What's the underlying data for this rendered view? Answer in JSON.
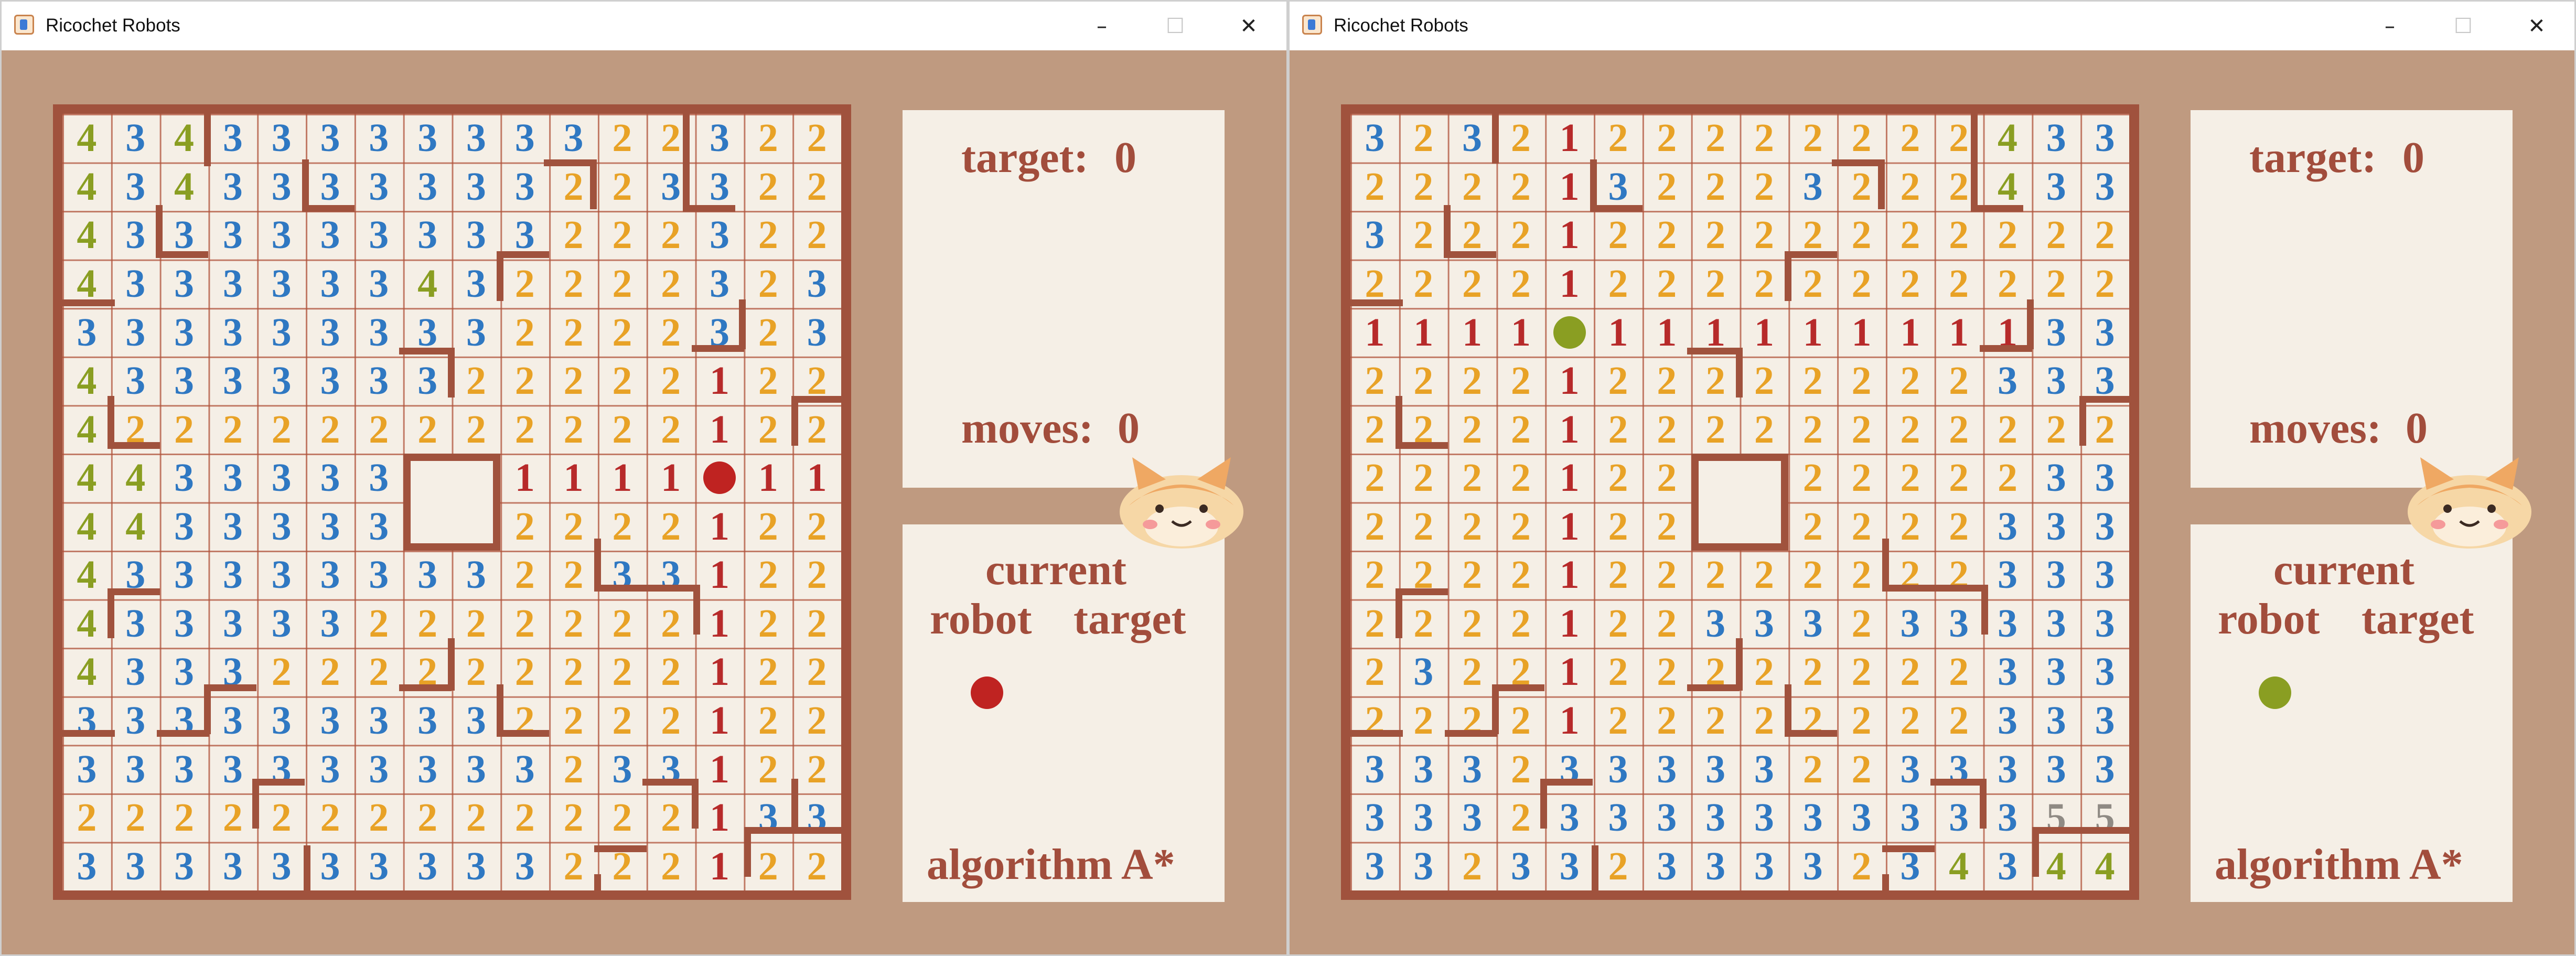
{
  "colors": {
    "1": "#b72a2a",
    "2": "#e8a226",
    "3": "#2f78c2",
    "4": "#8a9e22",
    "5": "#8f8a84"
  },
  "windows": [
    {
      "title": "Ricochet Robots",
      "info": {
        "target_label": "target:",
        "target_value": "0",
        "moves_label": "moves:",
        "moves_value": "0",
        "current_label": "current",
        "robot_label": "robot",
        "target_word": "target",
        "algorithm_label": "algorithm A*",
        "current_robot_color": "#bf2321"
      },
      "board": {
        "size": 16,
        "rows": [
          "4343333333322322",
          "4343333333223322",
          "4333333333222322",
          "4333333432222323",
          "3333333332222323",
          "4333333322222122",
          "4222222222222122",
          "4433333  1111X11",
          "4433333  2222122",
          "4333333332233122",
          "4333332222222122",
          "4333222222222122",
          "3333333332222122",
          "3333333333233122",
          "2222222222222133",
          "3333333333222122"
        ],
        "robots": [
          {
            "row": 7,
            "col": 13,
            "color": "#bf2321"
          }
        ],
        "center_block": [
          7,
          7
        ]
      }
    },
    {
      "title": "Ricochet Robots",
      "info": {
        "target_label": "target:",
        "target_value": "0",
        "moves_label": "moves:",
        "moves_value": "0",
        "current_label": "current",
        "robot_label": "robot",
        "target_word": "target",
        "algorithm_label": "algorithm A*",
        "current_robot_color": "#8a9e22"
      },
      "board": {
        "size": 16,
        "rows": [
          "3232122222222433",
          "2222132223222433",
          "3222122222222222",
          "2222122222222222",
          "1111X11111111133",
          "2222122222222333",
          "2222122222222222",
          "2222122  2222233",
          "2222122  2222333",
          "2222122222222333",
          "2222122333233333",
          "2322122222222333",
          "2222122222222333",
          "3332333332233333",
          "3332333333333355",
          "3323323333234344"
        ],
        "robots": [
          {
            "row": 4,
            "col": 4,
            "color": "#8a9e22"
          }
        ],
        "center_block": [
          7,
          7
        ]
      }
    }
  ],
  "window_buttons": {
    "minimize": "–",
    "maximize": "☐",
    "close": "✕"
  }
}
